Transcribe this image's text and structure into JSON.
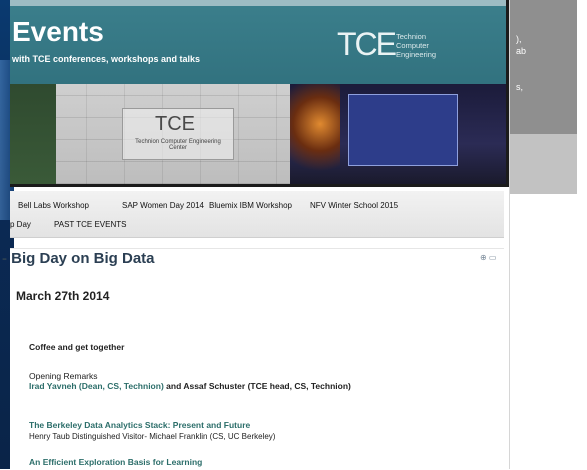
{
  "banner": {
    "title": "Events",
    "subtitle": "with TCE conferences, workshops and talks",
    "logo_letters": "TCE",
    "logo_text_line1": "Technion",
    "logo_text_line2": "Computer",
    "logo_text_line3": "Engineering",
    "plaque_big": "TCE",
    "plaque_small": "Technion Computer Engineering Center"
  },
  "nav": {
    "row1": [
      "Bell Labs Workshop",
      "SAP Women Day 2014",
      "Bluemix IBM Workshop",
      "NFV Winter School 2015"
    ],
    "row2": [
      "p Day",
      "PAST TCE EVENTS"
    ]
  },
  "page": {
    "title": "- Big Day on Big Data",
    "date": "March 27th 2014",
    "coffee": "Coffee and get together",
    "remarks": "Opening Remarks",
    "speaker1": "Irad Yavneh (Dean, CS, Technion)",
    "speaker_and": "and",
    "speaker2": "Assaf Schuster (TCE head, CS, Technion)",
    "talk1_title": "The Berkeley Data Analytics Stack: Present and Future",
    "talk1_sub": "Henry Taub Distinguished Visitor- Michael Franklin (CS, UC Berkeley)",
    "talk2_title": "An Efficient Exploration Basis for Learning"
  },
  "right_panel": {
    "line1": "),",
    "line2": "ab",
    "line3": "s,"
  },
  "icons": {
    "title_icons": "⊕ ▭"
  }
}
